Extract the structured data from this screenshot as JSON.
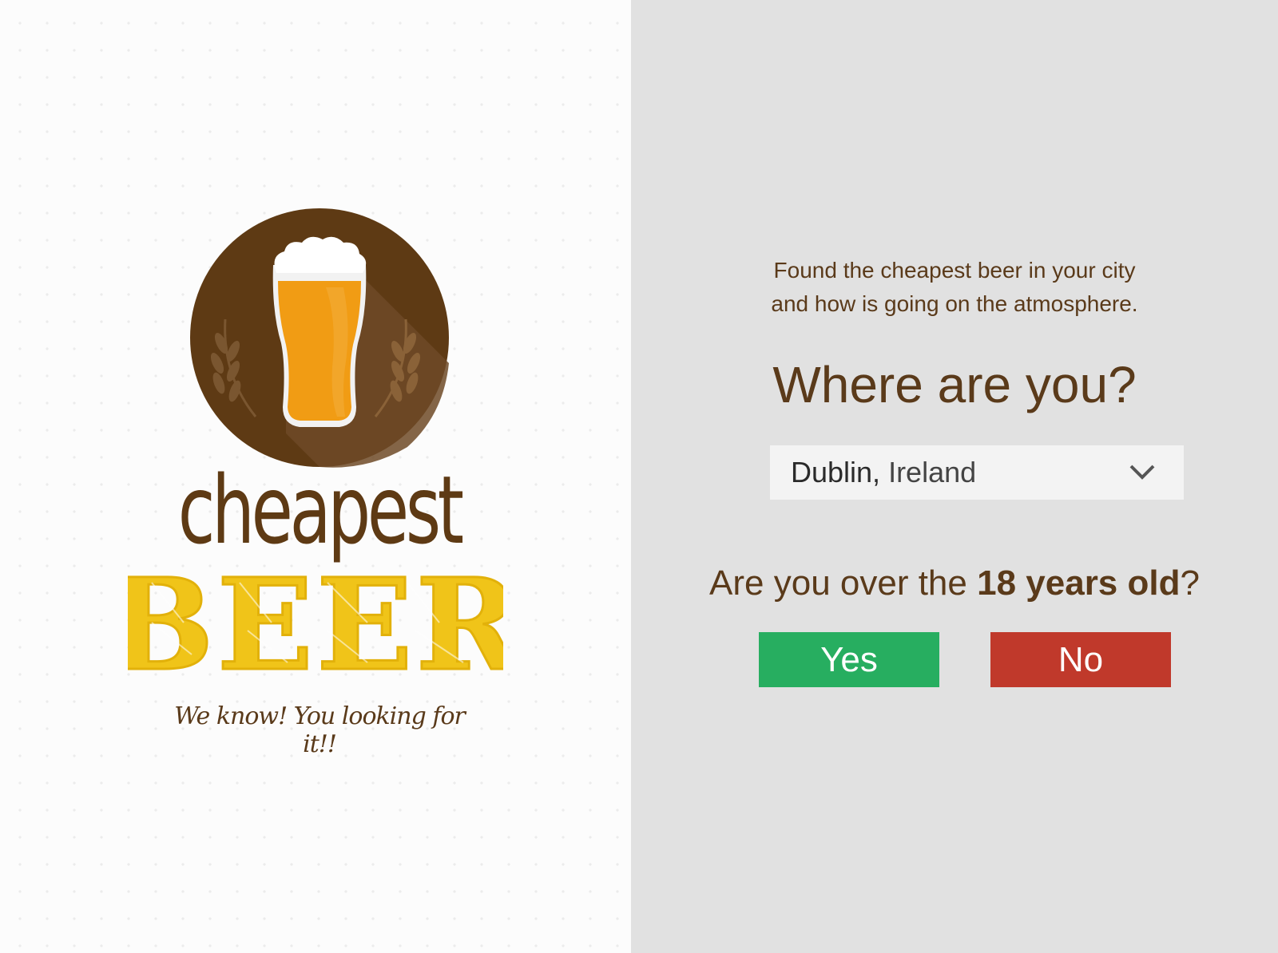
{
  "colors": {
    "brand_brown": "#5a3a1a",
    "logo_circle": "#5e3a14",
    "beer_amber": "#f19c14",
    "beer_yellow": "#f0c419",
    "yes_green": "#27ae60",
    "no_red": "#c0392b",
    "right_bg": "#e1e1e1"
  },
  "logo": {
    "word_top": "cheapest",
    "word_main": "BEER",
    "tagline": "We know! You looking for it!!",
    "icon": "beer-glass-icon"
  },
  "intro": {
    "line1": "Found the cheapest beer in your city",
    "line2": "and how is going on the atmosphere."
  },
  "location": {
    "question": "Where are you?",
    "city": "Dublin,",
    "country": "Ireland",
    "icon": "chevron-down-icon"
  },
  "age": {
    "prefix": "Are you over the ",
    "emphasis": "18 years old",
    "suffix": "?",
    "yes_label": "Yes",
    "no_label": "No"
  }
}
